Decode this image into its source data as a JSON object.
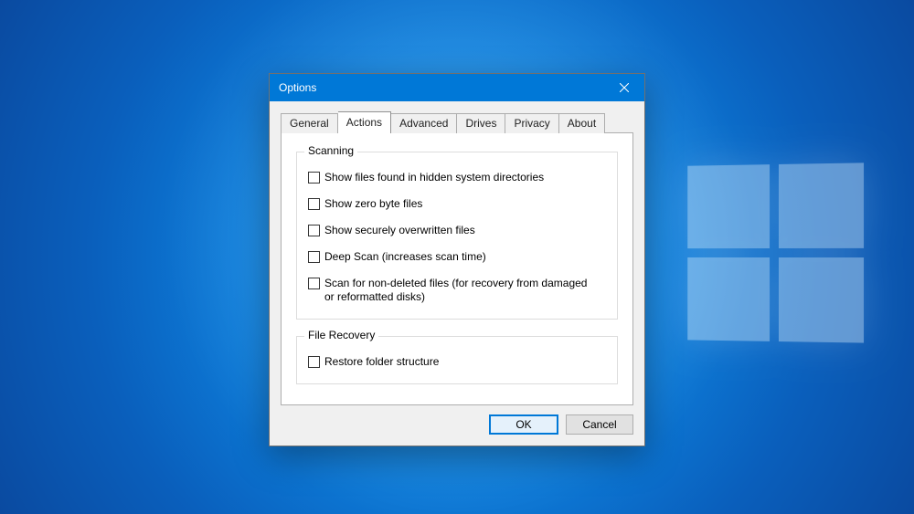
{
  "window": {
    "title": "Options",
    "close_label": "Close"
  },
  "tabs": {
    "general": "General",
    "actions": "Actions",
    "advanced": "Advanced",
    "drives": "Drives",
    "privacy": "Privacy",
    "about": "About",
    "active": "actions"
  },
  "groups": {
    "scanning": {
      "title": "Scanning",
      "items": [
        "Show files found in hidden system directories",
        "Show zero byte files",
        "Show securely overwritten files",
        "Deep Scan (increases scan time)",
        "Scan for non-deleted files (for recovery from damaged or reformatted disks)"
      ]
    },
    "file_recovery": {
      "title": "File Recovery",
      "items": [
        "Restore folder structure"
      ]
    }
  },
  "buttons": {
    "ok": "OK",
    "cancel": "Cancel"
  }
}
